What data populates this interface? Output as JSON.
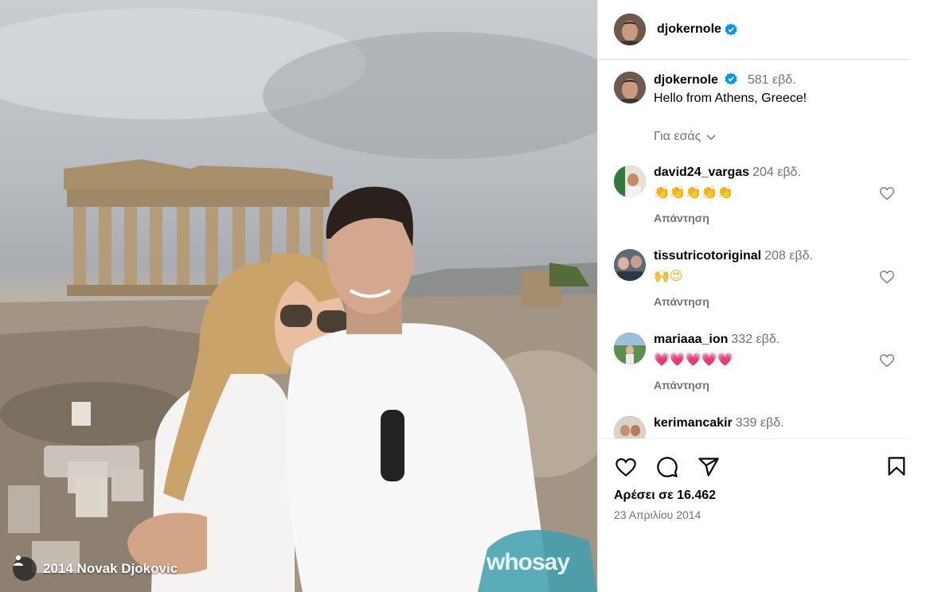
{
  "photo": {
    "credit": "2014 Novak Djokovic",
    "watermark": "whosay"
  },
  "post": {
    "username": "djokernole",
    "caption": "Hello from Athens, Greece!",
    "age": "581 εβδ.",
    "translate_label": "Για εσάς",
    "likes": "Αρέσει σε 16.462",
    "date": "23 Απριλίου 2014"
  },
  "comments": [
    {
      "username": "david24_vargas",
      "age": "204 εβδ.",
      "text": "👏👏👏👏👏",
      "reply": "Απάντηση"
    },
    {
      "username": "tissutricotoriginal",
      "age": "208 εβδ.",
      "text": "🙌😍",
      "reply": "Απάντηση"
    },
    {
      "username": "mariaaa_ion",
      "age": "332 εβδ.",
      "text": "💗💗💗💗💗",
      "reply": "Απάντηση"
    },
    {
      "username": "kerimancakir",
      "age": "339 εβδ.",
      "text": "",
      "reply": ""
    }
  ],
  "colors": {
    "verified": "#0095f6",
    "secondary_text": "#737373",
    "divider": "#dbdbdb"
  },
  "icons": [
    "verified-badge-icon",
    "chevron-down-icon",
    "heart-icon",
    "comment-icon",
    "share-icon",
    "bookmark-icon",
    "user-icon"
  ]
}
